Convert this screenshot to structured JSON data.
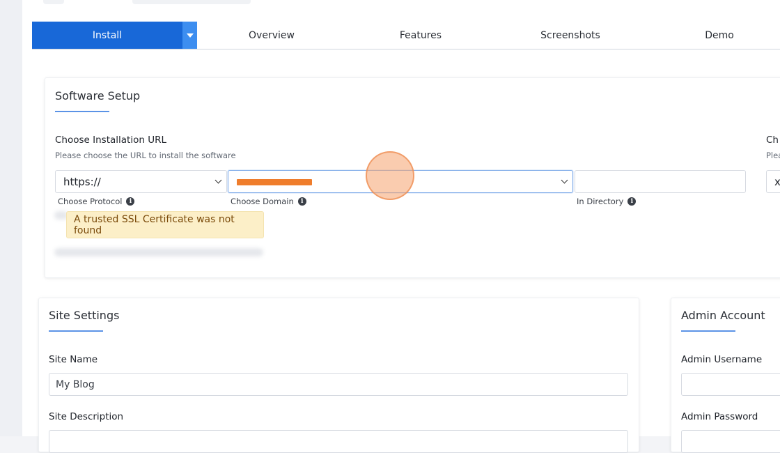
{
  "tabs": {
    "install_label": "Install",
    "items": [
      "Overview",
      "Features",
      "Screenshots",
      "Demo"
    ]
  },
  "software_setup": {
    "title": "Software Setup",
    "install_url_label": "Choose Installation URL",
    "install_url_hint": "Please choose the URL to install the software",
    "protocol_value": "https://",
    "protocol_label": "Choose Protocol",
    "domain_label": "Choose Domain",
    "directory_value": "",
    "directory_label": "In Directory",
    "ssl_warning": "A trusted SSL Certificate was not found",
    "right_label_partial": "Ch",
    "right_hint_partial": "Plea",
    "right_select_partial": "x"
  },
  "site_settings": {
    "title": "Site Settings",
    "site_name_label": "Site Name",
    "site_name_value": "My Blog",
    "site_description_label": "Site Description"
  },
  "admin_account": {
    "title": "Admin Account",
    "username_label": "Admin Username",
    "password_label": "Admin Password"
  },
  "colors": {
    "accent": "#1868d8",
    "warning_bg": "#fcefc8",
    "warning_text": "#7a4a0a",
    "redaction": "#ef7d2c"
  }
}
